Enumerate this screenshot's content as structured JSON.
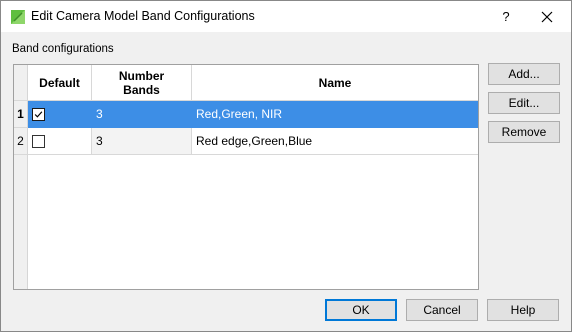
{
  "window": {
    "title": "Edit Camera Model Band Configurations",
    "help_glyph": "?"
  },
  "group": {
    "label": "Band configurations"
  },
  "table": {
    "columns": [
      "Default",
      "Number\nBands",
      "Name"
    ],
    "rows": [
      {
        "index": "1",
        "default": true,
        "bands": "3",
        "name": "Red,Green, NIR",
        "selected": true
      },
      {
        "index": "2",
        "default": false,
        "bands": "3",
        "name": "Red edge,Green,Blue",
        "selected": false
      }
    ]
  },
  "side_buttons": {
    "add": "Add...",
    "edit": "Edit...",
    "remove": "Remove"
  },
  "footer_buttons": {
    "ok": "OK",
    "cancel": "Cancel",
    "help": "Help"
  },
  "colors": {
    "selection": "#3d8ee6",
    "default_button_border": "#0078d7"
  }
}
